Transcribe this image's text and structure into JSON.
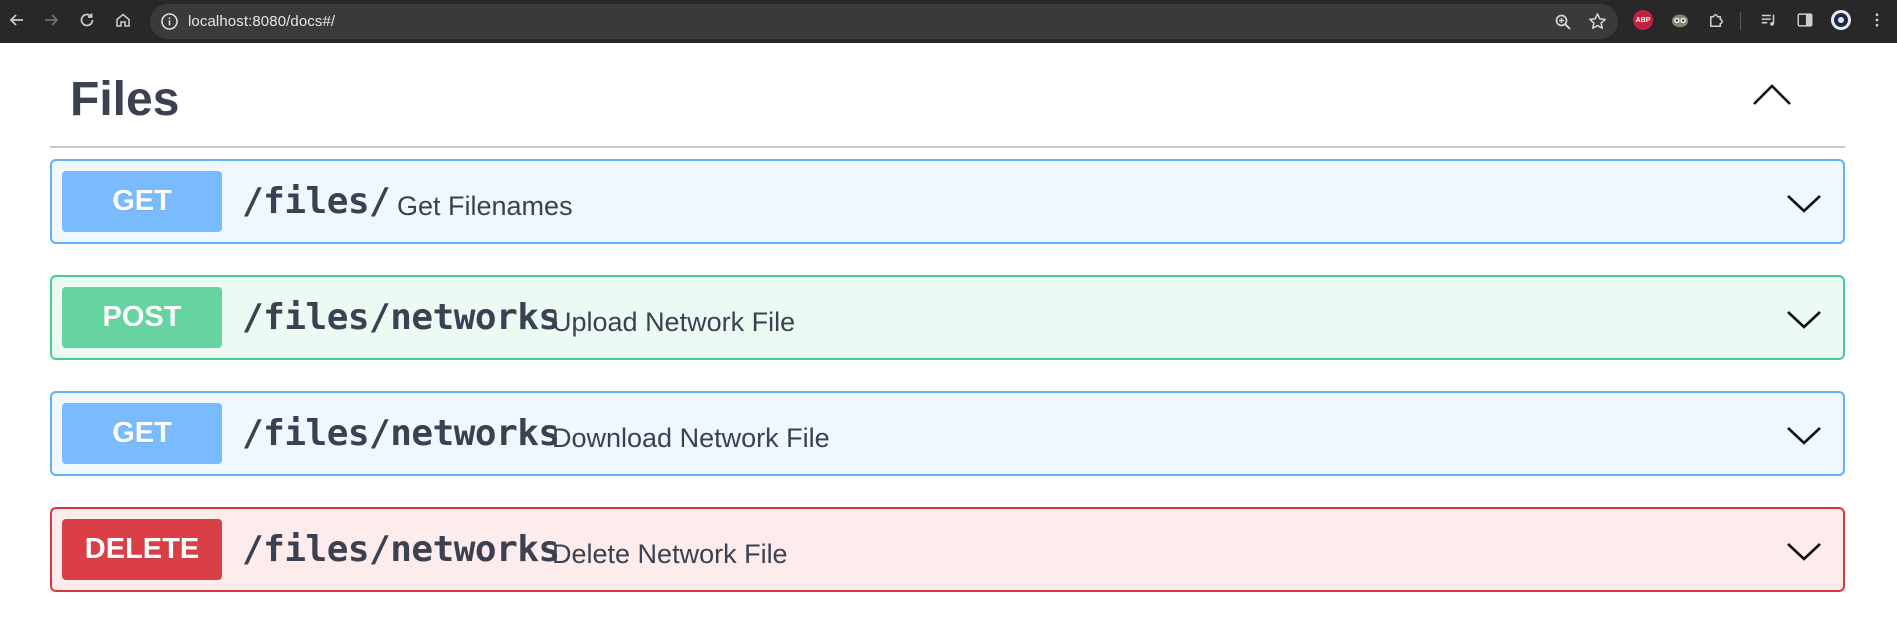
{
  "browser": {
    "url": "localhost:8080/docs#/"
  },
  "section": {
    "title": "Files"
  },
  "operations": [
    {
      "method": "GET",
      "path": "/files/",
      "summary": "Get Filenames"
    },
    {
      "method": "POST",
      "path": "/files/networks",
      "summary": "Upload Network File"
    },
    {
      "method": "GET",
      "path": "/files/networks",
      "summary": "Download Network File"
    },
    {
      "method": "DELETE",
      "path": "/files/networks",
      "summary": "Delete Network File"
    }
  ],
  "colors": {
    "get": "#61affe",
    "post": "#49cc90",
    "delete": "#d9363e",
    "text": "#3b4151"
  },
  "icons": {
    "nav": [
      "back-arrow-icon",
      "forward-arrow-icon",
      "reload-icon",
      "home-icon"
    ],
    "omnibox": [
      "site-info-icon",
      "zoom-icon",
      "bookmark-star-icon"
    ],
    "extensions": [
      "adblock-plus-icon",
      "owl-extension-icon",
      "puzzle-extensions-icon",
      "reading-list-icon",
      "side-panel-icon",
      "profile-avatar-icon",
      "kebab-menu-icon"
    ],
    "swagger": [
      "chevron-up-icon",
      "chevron-down-icon"
    ]
  }
}
